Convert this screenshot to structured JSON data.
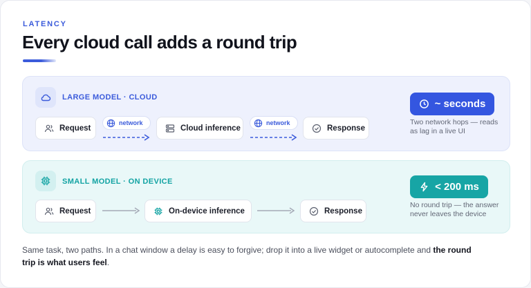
{
  "eyebrow": "LATENCY",
  "title": "Every cloud call adds a round trip",
  "cloud": {
    "label": "LARGE MODEL · CLOUD",
    "icon": "cloud-icon",
    "steps": [
      "Request",
      "Cloud inference",
      "Response"
    ],
    "hops": [
      "network",
      "network"
    ],
    "result": "~ seconds",
    "result_icon": "clock-icon",
    "note": [
      "Two network hops — reads",
      "as lag in a live UI"
    ],
    "color": "#3456e0"
  },
  "device": {
    "label": "SMALL MODEL · ON DEVICE",
    "icon": "chip-icon",
    "steps": [
      "Request",
      "On-device inference",
      "Response"
    ],
    "result": "< 200 ms",
    "result_icon": "lightning-icon",
    "note": [
      "No round trip — the answer",
      "never leaves the device"
    ],
    "color": "#17a5a5"
  },
  "footer": {
    "text": "Same task, two paths. In a chat window a delay is easy to forgive; drop it into a live widget or autocomplete and ",
    "emphasis": "the round trip is what users feel",
    "end": "."
  }
}
